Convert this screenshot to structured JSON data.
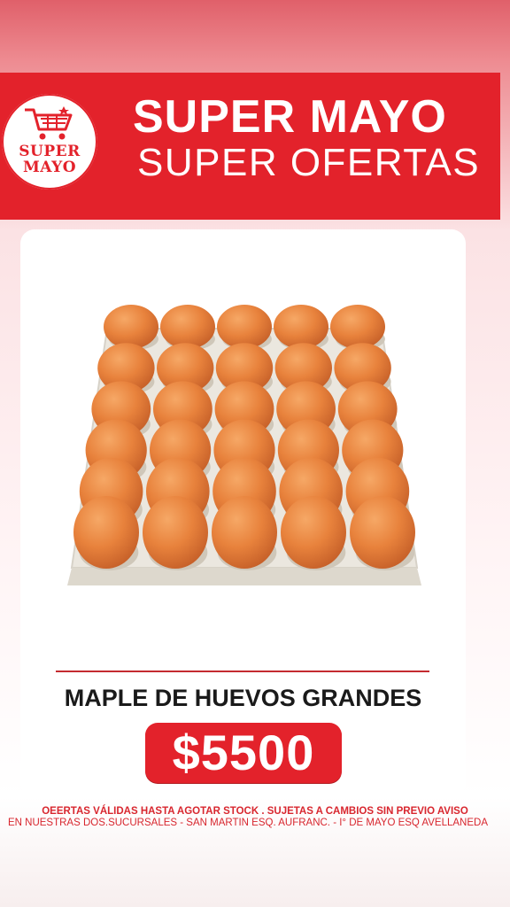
{
  "logo": {
    "line1": "SUPER",
    "line2": "MAYO",
    "icon": "shopping-cart-icon"
  },
  "header": {
    "title": "SUPER MAYO",
    "subtitle": "SUPER OFERTAS"
  },
  "product": {
    "name": "MAPLE DE HUEVOS GRANDES",
    "price": "$5500",
    "image": "egg-tray-image"
  },
  "footer": {
    "line1": "OEERTAS VÁLIDAS  HASTA AGOTAR STOCK . SUJETAS A CAMBIOS SIN PREVIO AVISO",
    "line2": "EN NUESTRAS DOS.SUCURSALES - SAN MARTIN ESQ. AUFRANC. - I° DE MAYO ESQ  AVELLANEDA"
  },
  "colors": {
    "brand_red": "#e3222b",
    "egg": "#e8823c",
    "tray": "#ebe7df"
  }
}
